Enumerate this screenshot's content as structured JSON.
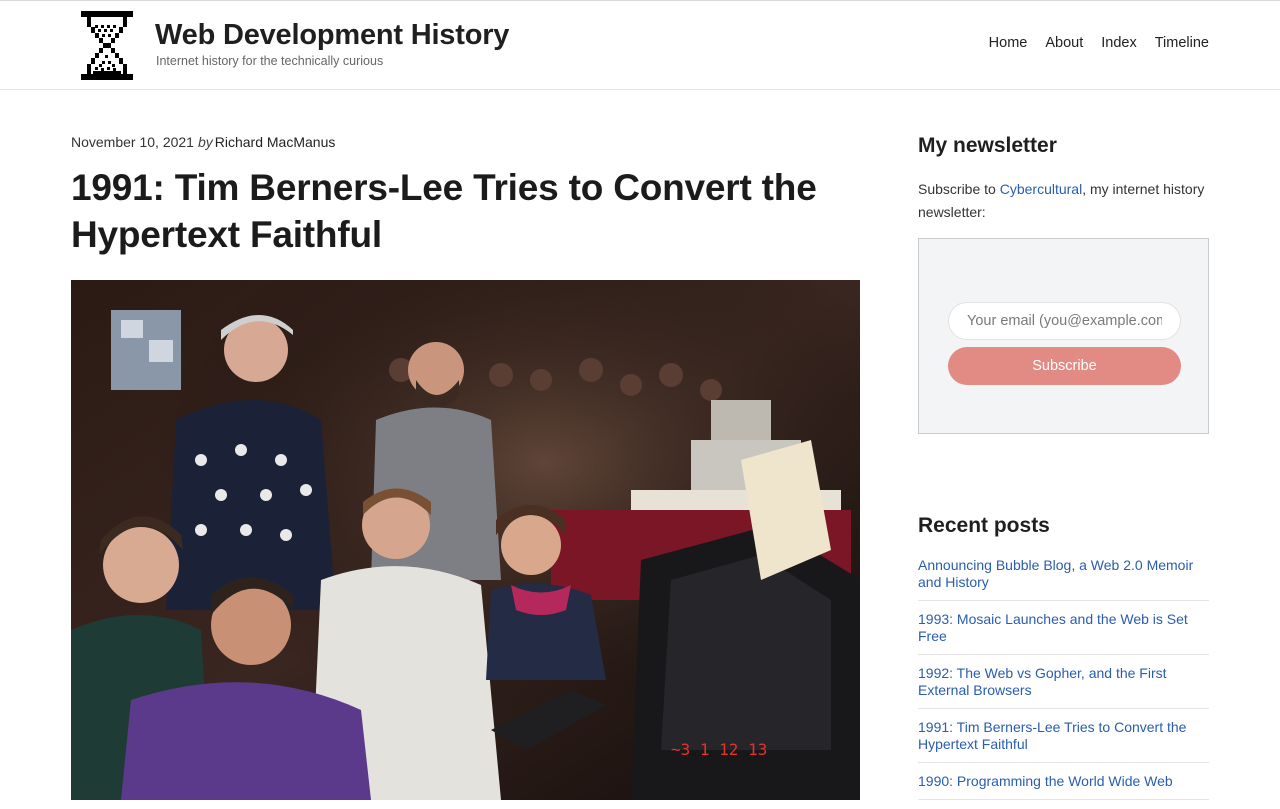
{
  "site": {
    "title": "Web Development History",
    "tagline": "Internet history for the technically curious",
    "nav": [
      "Home",
      "About",
      "Index",
      "Timeline"
    ]
  },
  "post": {
    "date": "November 10, 2021",
    "by": "by",
    "author": "Richard MacManus",
    "title": "1991: Tim Berners-Lee Tries to Convert the Hypertext Faithful"
  },
  "sidebar": {
    "newsletter": {
      "heading": "My newsletter",
      "text_before": "Subscribe to ",
      "link_text": "Cybercultural",
      "text_after": ", my internet history newsletter:",
      "email_placeholder": "Your email (you@example.com)",
      "subscribe_label": "Subscribe"
    },
    "recent": {
      "heading": "Recent posts",
      "items": [
        "Announcing Bubble Blog, a Web 2.0 Memoir and History",
        "1993: Mosaic Launches and the Web is Set Free",
        "1992: The Web vs Gopher, and the First External Browsers",
        "1991: Tim Berners-Lee Tries to Convert the Hypertext Faithful",
        "1990: Programming the World Wide Web"
      ]
    }
  },
  "colors": {
    "link": "#2a5db0",
    "subscribe_button": "#e28a84",
    "newsletter_box": "#f3f4f5"
  }
}
